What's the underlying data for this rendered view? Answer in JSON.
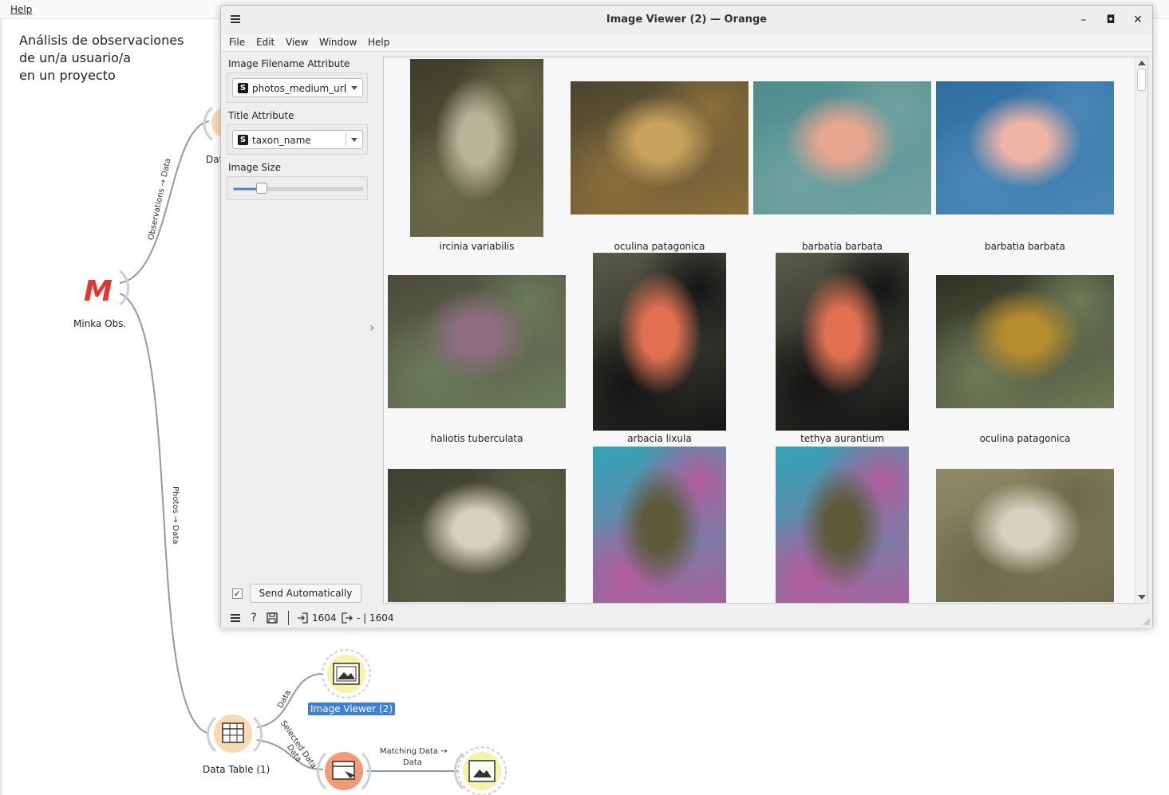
{
  "app_menu": {
    "help": "Help"
  },
  "canvas": {
    "note": "Análisis de observaciones\nde un/a usuario/a\nen un proyecto",
    "nodes": {
      "minka": "Minka Obs.",
      "data_partial": "Dat",
      "data_table": "Data Table (1)",
      "image_viewer_2": "Image Viewer (2)"
    },
    "links": {
      "observations_data": "Observations → Data",
      "photos_data": "Photos → Data",
      "data": "Data",
      "selected_data": "Selected Data",
      "data2": "Data",
      "matching_data_line1": "Matching Data →",
      "matching_data_line2": "Data"
    }
  },
  "window": {
    "title": "Image Viewer (2) — Orange",
    "menu": [
      "File",
      "Edit",
      "View",
      "Window",
      "Help"
    ],
    "controls": {
      "image_filename_label": "Image Filename Attribute",
      "image_filename_value": "photos_medium_url",
      "title_attr_label": "Title Attribute",
      "title_attr_value": "taxon_name",
      "image_size_label": "Image Size",
      "image_size_fraction": 0.22,
      "send_auto_label": "Send Automatically",
      "send_auto_checked": "✓"
    },
    "images": [
      {
        "caption": "ircinia variabilis",
        "palette": [
          "#3e3b28",
          "#b9b39a",
          "#6b6a4a"
        ]
      },
      {
        "caption": "oculina patagonica",
        "palette": [
          "#4a4530",
          "#c7a35e",
          "#8b6f3a"
        ]
      },
      {
        "caption": "barbatia barbata",
        "palette": [
          "#4f8c8e",
          "#e7a690",
          "#6fa3a0"
        ]
      },
      {
        "caption": "barbatia barbata",
        "palette": [
          "#2e6ea0",
          "#f0b4a6",
          "#4a88b8"
        ]
      },
      {
        "caption": "haliotis tuberculata",
        "palette": [
          "#4c4a3a",
          "#8c6e7e",
          "#6c7a5c"
        ]
      },
      {
        "caption": "arbacia lixula",
        "palette": [
          "#5a5a48",
          "#e07050",
          "#151515"
        ]
      },
      {
        "caption": "tethya aurantium",
        "palette": [
          "#5a5a48",
          "#e07050",
          "#151515"
        ]
      },
      {
        "caption": "oculina patagonica",
        "palette": [
          "#2f3222",
          "#b58c2e",
          "#6e7a58"
        ]
      },
      {
        "caption": "",
        "palette": [
          "#3e4030",
          "#d8cfc0",
          "#5b5e45"
        ]
      },
      {
        "caption": "",
        "palette": [
          "#2fa6b6",
          "#5e5a3a",
          "#b35b9a"
        ]
      },
      {
        "caption": "",
        "palette": [
          "#2fa6b6",
          "#5e5a3a",
          "#b35b9a"
        ]
      },
      {
        "caption": "",
        "palette": [
          "#8f8a66",
          "#d7d2c0",
          "#6d6a4e"
        ]
      }
    ],
    "status": {
      "input_count": "1604",
      "output_text": "- | 1604"
    }
  }
}
